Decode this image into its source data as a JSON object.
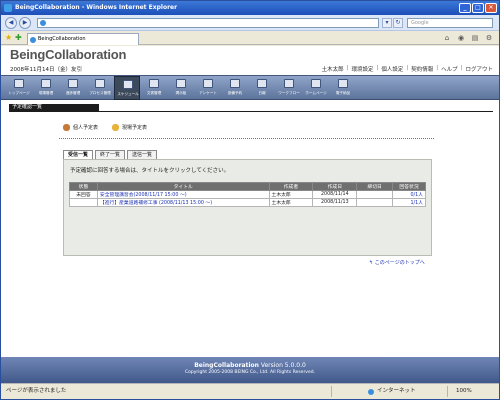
{
  "window": {
    "title": "BeingCollaboration - Windows Internet Explorer",
    "address": "",
    "search_placeholder": "Google",
    "tab_label": "BeingCollaboration",
    "status_text": "ページが表示されました",
    "zone_text": "インターネット",
    "zoom_text": "100%"
  },
  "header": {
    "logo": "BeingCollaboration",
    "date": "2008年11月14日（金）友引",
    "user": "土木太郎",
    "links": [
      "環境設定",
      "個人設定",
      "契約情報",
      "ヘルプ",
      "ログアウト"
    ]
  },
  "menu": [
    {
      "label": "トップページ",
      "icon": "home-icon"
    },
    {
      "label": "現場管理",
      "icon": "site-icon"
    },
    {
      "label": "進捗管理",
      "icon": "progress-icon"
    },
    {
      "label": "プロセス管理",
      "icon": "process-icon"
    },
    {
      "label": "スケジュール",
      "icon": "schedule-icon"
    },
    {
      "label": "文書管理",
      "icon": "folder-icon"
    },
    {
      "label": "掲示板",
      "icon": "board-icon"
    },
    {
      "label": "アンケート",
      "icon": "survey-icon"
    },
    {
      "label": "設備予約",
      "icon": "reservation-icon"
    },
    {
      "label": "日報",
      "icon": "report-icon"
    },
    {
      "label": "ワークフロー",
      "icon": "workflow-icon"
    },
    {
      "label": "ホームページ",
      "icon": "homepage-icon"
    },
    {
      "label": "電子納品",
      "icon": "delivery-icon"
    }
  ],
  "active_menu_index": 4,
  "section_title": "予定確認一覧",
  "legend": {
    "personal": "個人予定表",
    "shared": "現場予定表"
  },
  "tabs": [
    "受信一覧",
    "終了一覧",
    "送信一覧"
  ],
  "active_tab_index": 0,
  "panel": {
    "note": "予定確認に回答する場合は、タイトルをクリックしてください。",
    "columns": [
      "状態",
      "タイトル",
      "作成者",
      "作成日",
      "締切日",
      "回答状況"
    ],
    "rows": [
      {
        "status": "未回答",
        "title": "安全管理講習会(2008/11/17 15:00 ～)",
        "creator": "土木太郎",
        "created": "2008/11/14",
        "deadline": "",
        "answers": "0/1人"
      },
      {
        "status": "",
        "title": "【進行】産業道路補修工事 (2008/11/13 15:00 ～)",
        "creator": "土木太郎",
        "created": "2008/11/13",
        "deadline": "",
        "answers": "1/1人"
      }
    ]
  },
  "to_top": "このページのトップへ",
  "footer": {
    "name": "BeingCollaboration",
    "version": "Version 5.0.0.0",
    "copyright": "Copyright 2005-2008 BEING Co., Ltd. All Rights Reserved."
  }
}
